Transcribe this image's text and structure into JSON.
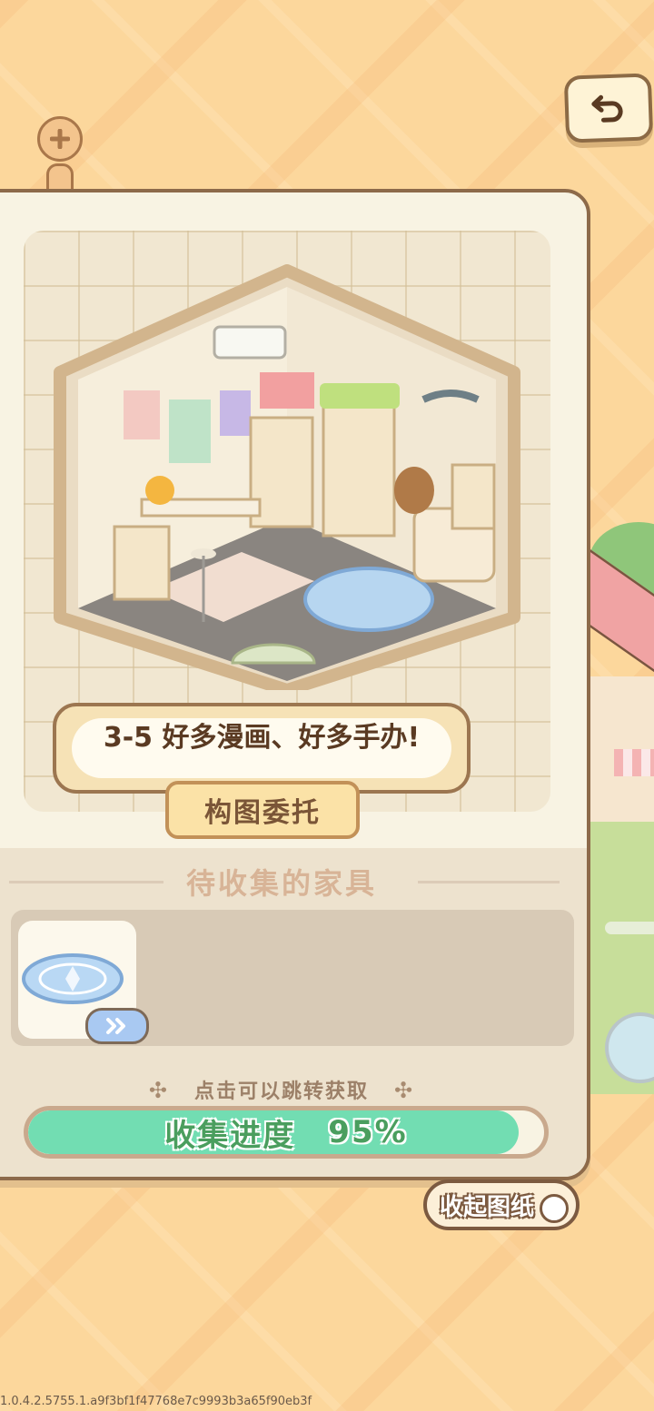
{
  "header": {
    "back_icon": "undo-arrow-icon",
    "zoom_icon": "plus-icon"
  },
  "blueprint": {
    "level_title": "3-5 好多漫画、好多手办!",
    "commission_label": "构图委托"
  },
  "furniture": {
    "section_title": "待收集的家具",
    "items": [
      {
        "name_icon": "blue-round-rug-icon",
        "goto_icon": "double-chevron-right-icon"
      }
    ],
    "hint": "点击可以跳转获取"
  },
  "progress": {
    "label": "收集进度",
    "value_text": "95%",
    "fraction": 0.95
  },
  "collapse_label": "收起图纸",
  "version": "1.0.4.2.5755.1.a9f3bf1f47768e7c9993b3a65f90eb3f",
  "colors": {
    "background": "#FCD79C",
    "panel": "#F8F3E3",
    "progress_fill": "#72DDB2",
    "accent_brown": "#8D6A4A"
  }
}
